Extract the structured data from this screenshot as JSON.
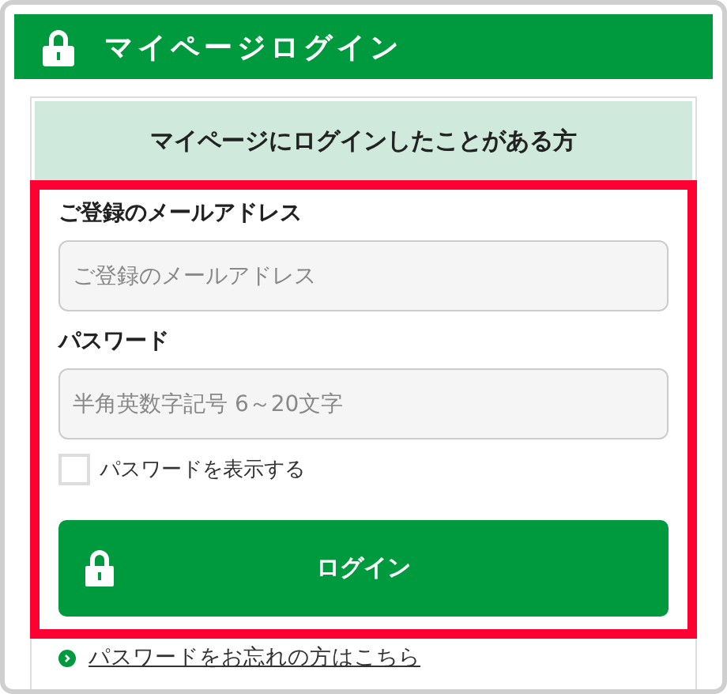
{
  "header": {
    "title": "マイページログイン"
  },
  "section": {
    "heading": "マイページにログインしたことがある方"
  },
  "email": {
    "label": "ご登録のメールアドレス",
    "placeholder": "ご登録のメールアドレス"
  },
  "password": {
    "label": "パスワード",
    "placeholder": "半角英数字記号 6～20文字"
  },
  "show_password": {
    "label": "パスワードを表示する",
    "checked": false
  },
  "login_button": {
    "label": "ログイン"
  },
  "forgot_link": {
    "label": "パスワードをお忘れの方はこちら"
  }
}
